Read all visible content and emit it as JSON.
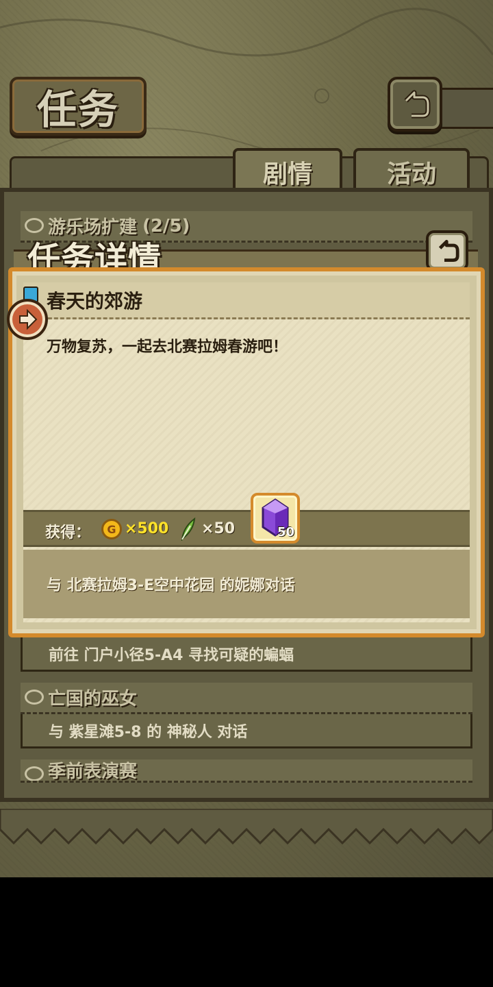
{
  "header": {
    "title": "任务"
  },
  "tabs": [
    {
      "label": "剧情",
      "active": true
    },
    {
      "label": "活动",
      "active": false
    }
  ],
  "quest_list": [
    {
      "title": "游乐场扩建",
      "progress": "(2/5)"
    },
    {
      "objective": "前往 门户小径5-A4 寻找可疑的蝙蝠"
    },
    {
      "title": "亡国的巫女",
      "objective": "与 紫星滩5-8 的 神秘人 对话"
    },
    {
      "title": "季前表演赛"
    }
  ],
  "modal": {
    "title": "任务详情",
    "quest_name": "春天的郊游",
    "description": "万物复苏，一起去北赛拉姆春游吧！",
    "reward_label": "获得：",
    "coin_symbol": "G",
    "coin_amount": "×500",
    "feather_amount": "×50",
    "gem_amount": "50",
    "target": "与 北赛拉姆3-E空中花园 的妮娜对话"
  },
  "colors": {
    "accent": "#d48a2c",
    "coin": "#f4b81a",
    "coin_text": "#ffe22a",
    "gem": "#8a4ad8",
    "marker": "#c8603a"
  }
}
